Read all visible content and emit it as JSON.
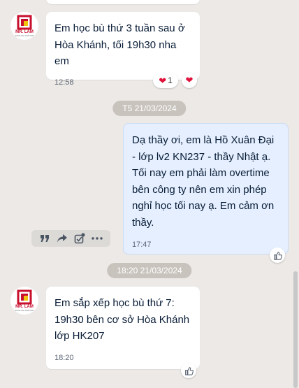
{
  "messages": [
    {
      "direction": "incoming",
      "text": "Em học bù thứ 3 tuần sau ở Hòa Khánh, tối 19h30 nha em",
      "time": "12:58",
      "reaction": {
        "icon": "heart-icon",
        "emoji": "❤",
        "count": "1"
      },
      "quick_reaction": {
        "icon": "heart-icon",
        "emoji": "❤"
      }
    },
    {
      "direction": "outgoing",
      "text": "Dạ thầy ơi, em là Hồ Xuân Đại - lớp lv2 KN237 - thầy Nhật ạ. Tối nay em phải làm overtime bên công ty nên em xin phép nghỉ học tối nay ạ. Em cảm ơn thầy.",
      "time": "17:47"
    },
    {
      "direction": "incoming",
      "text": "Em sắp xếp học bù thứ 7: 19h30 bên cơ sở Hòa Khánh lớp HK207",
      "time": "18:20"
    }
  ],
  "separators": [
    {
      "label": "T5 21/03/2024"
    },
    {
      "label": "18:20 21/03/2024"
    }
  ],
  "avatar": {
    "logo_text": "MR. LAM",
    "logo_subtext": "ENGLISH CENTER"
  },
  "message_toolbar": {
    "actions": [
      "quote-icon",
      "share-icon",
      "select-icon",
      "more-icon"
    ]
  },
  "colors": {
    "background": "#ece9e6",
    "incoming_bubble": "#ffffff",
    "outgoing_bubble": "#e5efff",
    "text": "#081c36",
    "timestamp": "#5a6473",
    "separator": "#c8c3bd",
    "heart": "#e0113a"
  }
}
